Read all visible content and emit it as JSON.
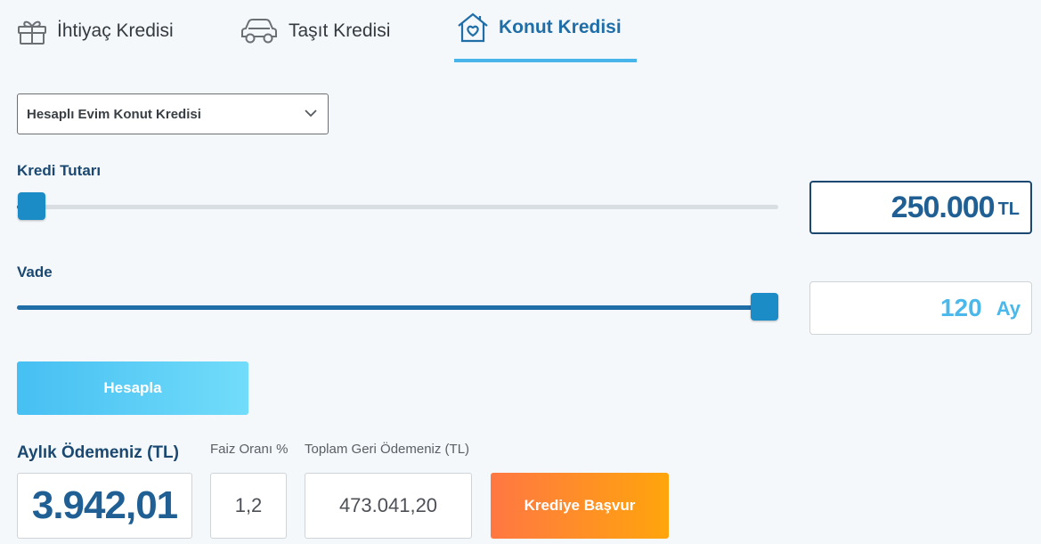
{
  "tabs": [
    {
      "label": "İhtiyaç Kredisi",
      "icon": "gift-icon",
      "active": false
    },
    {
      "label": "Taşıt Kredisi",
      "icon": "car-icon",
      "active": false
    },
    {
      "label": "Konut Kredisi",
      "icon": "home-heart-icon",
      "active": true
    }
  ],
  "product_select": {
    "value": "Hesaplı Evim Konut Kredisi"
  },
  "amount": {
    "label": "Kredi Tutarı",
    "value": "250.000",
    "unit": "TL",
    "slider_fraction": 0.0
  },
  "term": {
    "label": "Vade",
    "value": "120",
    "unit": "Ay",
    "slider_fraction": 1.0
  },
  "calculate_label": "Hesapla",
  "results": {
    "monthly_label": "Aylık Ödemeniz (TL)",
    "monthly_value": "3.942,01",
    "rate_label": "Faiz Oranı %",
    "rate_value": "1,2",
    "total_label": "Toplam Geri Ödemeniz (TL)",
    "total_value": "473.041,20"
  },
  "apply_label": "Krediye Başvur",
  "colors": {
    "accent": "#1f6ea8",
    "tab_underline": "#47b4ea",
    "calc_button": "#46bff2",
    "apply_button_start": "#ff7743",
    "apply_button_end": "#ffa50c"
  }
}
